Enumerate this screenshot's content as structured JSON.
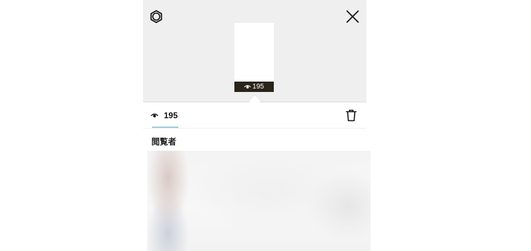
{
  "header": {
    "settings_icon": "gear-icon",
    "close_icon": "close-icon"
  },
  "story_thumbnail": {
    "view_icon": "eye-icon",
    "view_count": "195"
  },
  "tabs": {
    "views": {
      "icon": "eye-icon",
      "count": "195"
    },
    "delete_icon": "trash-icon",
    "active_underline_color": "#8fd3e6"
  },
  "viewers": {
    "title": "閲覧者"
  },
  "colors": {
    "top_background": "#efefef",
    "thumb_bar": "#2a2419"
  }
}
